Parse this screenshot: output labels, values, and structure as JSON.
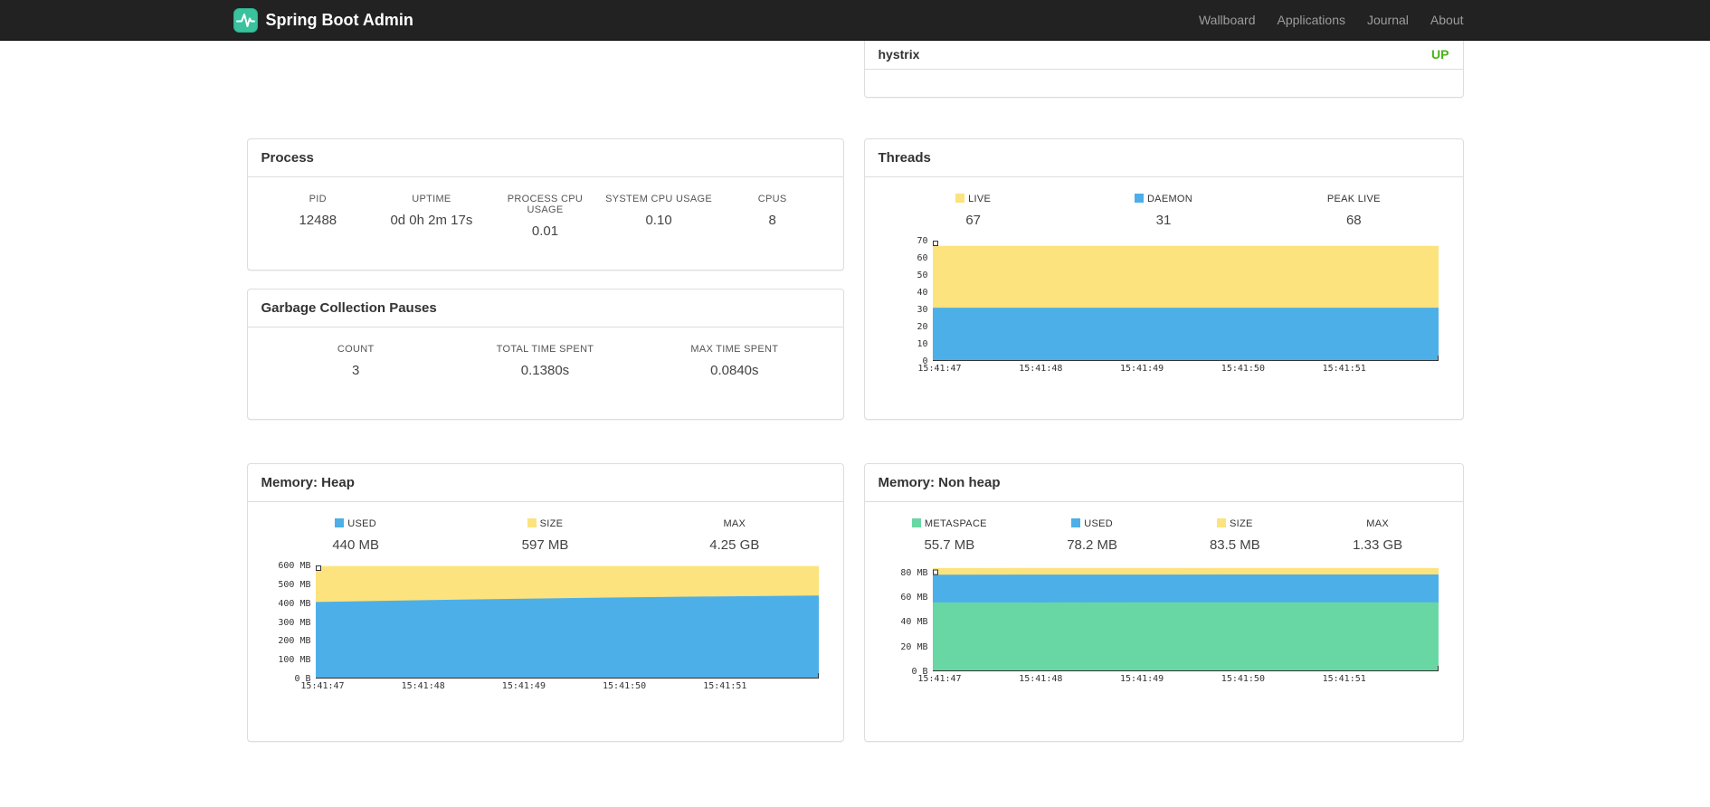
{
  "navbar": {
    "brand": "Spring Boot Admin",
    "items": [
      {
        "label": "Wallboard"
      },
      {
        "label": "Applications"
      },
      {
        "label": "Journal"
      },
      {
        "label": "About"
      }
    ]
  },
  "applications": {
    "rows": [
      {
        "name": "hystrix",
        "status": "UP"
      }
    ]
  },
  "cards": {
    "process": {
      "title": "Process",
      "stats": [
        {
          "label": "PID",
          "value": "12488"
        },
        {
          "label": "UPTIME",
          "value": "0d 0h 2m 17s"
        },
        {
          "label": "PROCESS CPU USAGE",
          "value": "0.01"
        },
        {
          "label": "SYSTEM CPU USAGE",
          "value": "0.10"
        },
        {
          "label": "CPUS",
          "value": "8"
        }
      ]
    },
    "gc": {
      "title": "Garbage Collection Pauses",
      "stats": [
        {
          "label": "COUNT",
          "value": "3"
        },
        {
          "label": "TOTAL TIME SPENT",
          "value": "0.1380s"
        },
        {
          "label": "MAX TIME SPENT",
          "value": "0.0840s"
        }
      ]
    },
    "threads": {
      "title": "Threads",
      "legend": [
        {
          "label": "LIVE",
          "value": "67",
          "swatch": "#fce37e"
        },
        {
          "label": "DAEMON",
          "value": "31",
          "swatch": "#4dafe8"
        },
        {
          "label": "PEAK LIVE",
          "value": "68",
          "swatch": null
        }
      ]
    },
    "memory_heap": {
      "title": "Memory: Heap",
      "legend": [
        {
          "label": "USED",
          "value": "440 MB",
          "swatch": "#4dafe8"
        },
        {
          "label": "SIZE",
          "value": "597 MB",
          "swatch": "#fce37e"
        },
        {
          "label": "MAX",
          "value": "4.25 GB",
          "swatch": null
        }
      ]
    },
    "memory_nonheap": {
      "title": "Memory: Non heap",
      "legend": [
        {
          "label": "METASPACE",
          "value": "55.7 MB",
          "swatch": "#69d7a3"
        },
        {
          "label": "USED",
          "value": "78.2 MB",
          "swatch": "#4dafe8"
        },
        {
          "label": "SIZE",
          "value": "83.5 MB",
          "swatch": "#fce37e"
        },
        {
          "label": "MAX",
          "value": "1.33 GB",
          "swatch": null
        }
      ]
    }
  },
  "colors": {
    "navbar_bg": "#222222",
    "brand_logo": "#38c29d",
    "status_up": "#47b414",
    "series_yellow": "#fce37e",
    "series_blue": "#4dafe8",
    "series_green": "#69d7a3",
    "panel_border": "#dddddd"
  },
  "chart_data": [
    {
      "type": "area",
      "title": "Threads",
      "x": [
        "15:41:47",
        "15:41:48",
        "15:41:49",
        "15:41:50",
        "15:41:51"
      ],
      "ylim": [
        0,
        70
      ],
      "y_ticks": [
        {
          "v": 70,
          "label": "70"
        },
        {
          "v": 60,
          "label": "60"
        },
        {
          "v": 50,
          "label": "50"
        },
        {
          "v": 40,
          "label": "40"
        },
        {
          "v": 30,
          "label": "30"
        },
        {
          "v": 20,
          "label": "20"
        },
        {
          "v": 10,
          "label": "10"
        },
        {
          "v": 0,
          "label": "0"
        }
      ],
      "series": [
        {
          "name": "LIVE",
          "color": "#fce37e",
          "values": [
            67,
            67,
            67,
            67,
            67,
            67
          ]
        },
        {
          "name": "DAEMON",
          "color": "#4dafe8",
          "values": [
            31,
            31,
            31,
            31,
            31,
            31
          ]
        }
      ],
      "legend_position": "top",
      "grid": false
    },
    {
      "type": "area",
      "title": "Memory: Heap",
      "x": [
        "15:41:47",
        "15:41:48",
        "15:41:49",
        "15:41:50",
        "15:41:51"
      ],
      "ylim": [
        0,
        600
      ],
      "y_ticks": [
        {
          "v": 600,
          "label": "600 MB"
        },
        {
          "v": 500,
          "label": "500 MB"
        },
        {
          "v": 400,
          "label": "400 MB"
        },
        {
          "v": 300,
          "label": "300 MB"
        },
        {
          "v": 200,
          "label": "200 MB"
        },
        {
          "v": 100,
          "label": "100 MB"
        },
        {
          "v": 0,
          "label": "0 B"
        }
      ],
      "series": [
        {
          "name": "SIZE",
          "color": "#fce37e",
          "values": [
            597,
            597,
            597,
            597,
            597,
            597
          ]
        },
        {
          "name": "USED",
          "color": "#4dafe8",
          "values": [
            406,
            415,
            423,
            430,
            436,
            440
          ]
        }
      ],
      "legend_position": "top",
      "grid": false
    },
    {
      "type": "area",
      "title": "Memory: Non heap",
      "x": [
        "15:41:47",
        "15:41:48",
        "15:41:49",
        "15:41:50",
        "15:41:51"
      ],
      "ylim": [
        0,
        85.5
      ],
      "y_ticks": [
        {
          "v": 80,
          "label": "80 MB"
        },
        {
          "v": 60,
          "label": "60 MB"
        },
        {
          "v": 40,
          "label": "40 MB"
        },
        {
          "v": 20,
          "label": "20 MB"
        },
        {
          "v": 0,
          "label": "0 B"
        }
      ],
      "series": [
        {
          "name": "SIZE",
          "color": "#fce37e",
          "values": [
            83.4,
            83.5,
            83.5,
            83.5,
            83.5,
            83.5
          ]
        },
        {
          "name": "USED",
          "color": "#4dafe8",
          "values": [
            78.0,
            78.1,
            78.1,
            78.2,
            78.2,
            78.2
          ]
        },
        {
          "name": "METASPACE",
          "color": "#69d7a3",
          "values": [
            55.6,
            55.6,
            55.7,
            55.7,
            55.7,
            55.7
          ]
        }
      ],
      "legend_position": "top",
      "grid": false
    }
  ]
}
